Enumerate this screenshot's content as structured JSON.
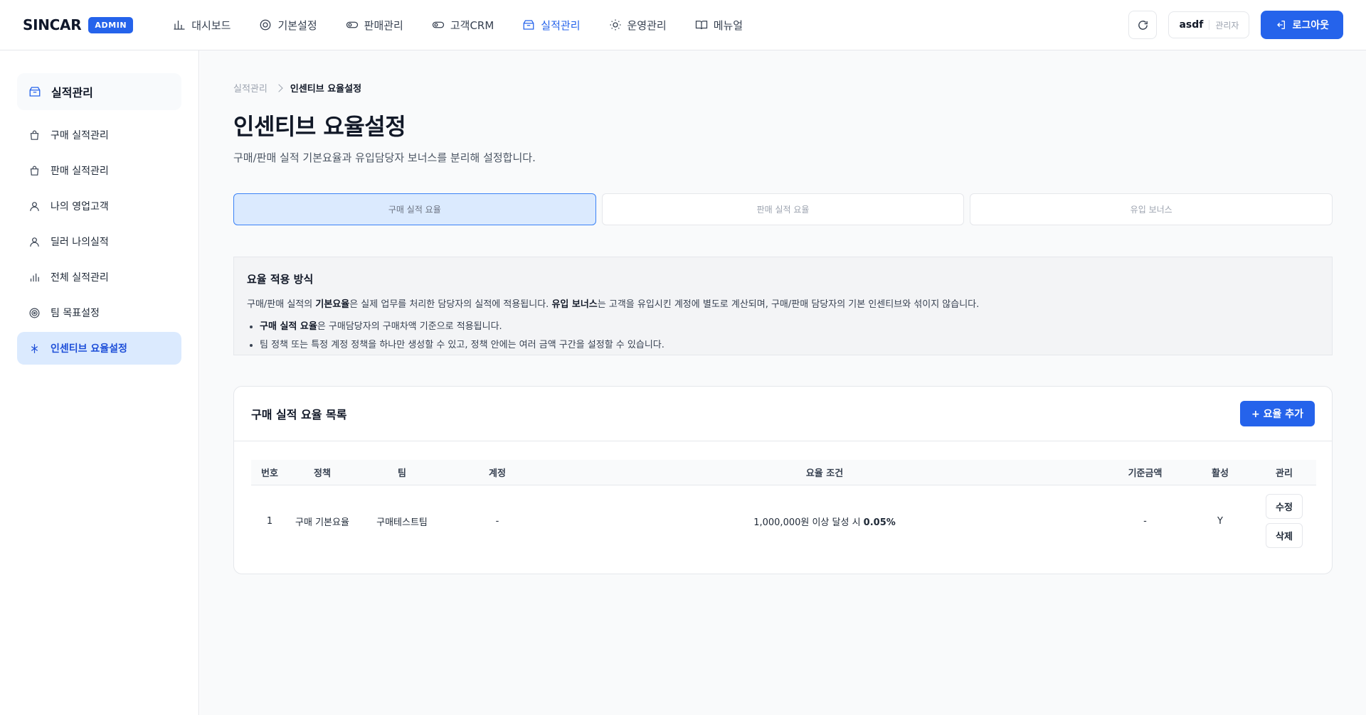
{
  "brand": {
    "name": "SINCAR",
    "badge": "ADMIN"
  },
  "nav": [
    {
      "label": "대시보드",
      "icon": "bar-chart-icon"
    },
    {
      "label": "기본설정",
      "icon": "target-icon"
    },
    {
      "label": "판매관리",
      "icon": "toggle-icon"
    },
    {
      "label": "고객CRM",
      "icon": "toggle-icon"
    },
    {
      "label": "실적관리",
      "icon": "box-icon",
      "active": true
    },
    {
      "label": "운영관리",
      "icon": "sun-icon"
    },
    {
      "label": "메뉴얼",
      "icon": "book-icon"
    }
  ],
  "user": {
    "name": "asdf",
    "role": "관리자"
  },
  "logout_label": "로그아웃",
  "sidebar": {
    "header": "실적관리",
    "items": [
      {
        "label": "구매 실적관리",
        "icon": "bag-icon"
      },
      {
        "label": "판매 실적관리",
        "icon": "bag-icon"
      },
      {
        "label": "나의 영업고객",
        "icon": "user-icon"
      },
      {
        "label": "딜러 나의실적",
        "icon": "user-icon"
      },
      {
        "label": "전체 실적관리",
        "icon": "bar-chart-icon"
      },
      {
        "label": "팀 목표설정",
        "icon": "target-icon"
      },
      {
        "label": "인센티브 요율설정",
        "icon": "asterisk-icon",
        "active": true
      }
    ]
  },
  "breadcrumb": {
    "parent": "실적관리",
    "current": "인센티브 요율설정"
  },
  "page": {
    "title": "인센티브 요율설정",
    "description": "구매/판매 실적 기본요율과 유입담당자 보너스를 분리해 설정합니다."
  },
  "tabs": [
    {
      "label": "구매 실적 요율",
      "active": true
    },
    {
      "label": "판매 실적 요율"
    },
    {
      "label": "유입 보너스"
    }
  ],
  "info": {
    "title": "요율 적용 방식",
    "line_part1": "구매/판매 실적의 ",
    "line_bold1": "기본요율",
    "line_part2": "은 실제 업무를 처리한 담당자의 실적에 적용됩니다. ",
    "line_bold2": "유입 보너스",
    "line_part3": "는 고객을 유입시킨 계정에 별도로 계산되며, 구매/판매 담당자의 기본 인센티브와 섞이지 않습니다.",
    "bullet1_bold": "구매 실적 요율",
    "bullet1_rest": "은 구매담당자의 구매차액 기준으로 적용됩니다.",
    "bullet2": "팀 정책 또는 특정 계정 정책을 하나만 생성할 수 있고, 정책 안에는 여러 금액 구간을 설정할 수 있습니다."
  },
  "list": {
    "title": "구매 실적 요율 목록",
    "add_label": "+ 요율 추가",
    "columns": [
      "번호",
      "정책",
      "팀",
      "계정",
      "요율 조건",
      "기준금액",
      "활성",
      "관리"
    ],
    "rows": [
      {
        "no": "1",
        "policy": "구매 기본요율",
        "team": "구매테스트팀",
        "account": "-",
        "condition_text": "1,000,000원 이상 달성 시 ",
        "condition_rate": "0.05%",
        "base_amount": "-",
        "active": "Y",
        "edit_label": "수정",
        "delete_label": "삭제"
      }
    ]
  },
  "colors": {
    "accent": "#2563eb",
    "active_bg": "#dbeafe"
  }
}
